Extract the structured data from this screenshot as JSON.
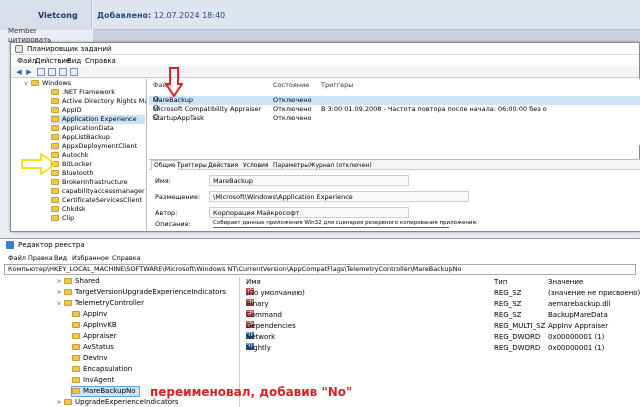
{
  "forum": {
    "username": "Vietcong",
    "added_label": "Добавлено:",
    "added_date": "12.07.2024 18:40",
    "member_line1": "Member",
    "member_line2": "цитировать"
  },
  "scheduler": {
    "title": "Планировщик заданий",
    "menu": [
      "Файл",
      "Действие",
      "Вид",
      "Справка"
    ],
    "tree": [
      {
        "label": "Windows",
        "indent": 0
      },
      {
        "label": ".NET Framework",
        "indent": 1
      },
      {
        "label": "Active Directory Rights Mana",
        "indent": 1
      },
      {
        "label": "AppID",
        "indent": 1
      },
      {
        "label": "Application Experience",
        "indent": 1,
        "selected": true
      },
      {
        "label": "ApplicationData",
        "indent": 1
      },
      {
        "label": "AppListBackup",
        "indent": 1
      },
      {
        "label": "AppxDeploymentClient",
        "indent": 1
      },
      {
        "label": "Autochk",
        "indent": 1
      },
      {
        "label": "BitLocker",
        "indent": 1
      },
      {
        "label": "Bluetooth",
        "indent": 1
      },
      {
        "label": "BrokerInfrastructure",
        "indent": 1
      },
      {
        "label": "capabilityaccessmanager",
        "indent": 1
      },
      {
        "label": "CertificateServicesClient",
        "indent": 1
      },
      {
        "label": "Chkdsk",
        "indent": 1
      },
      {
        "label": "Clip",
        "indent": 1
      }
    ],
    "columns": {
      "name": "Файл",
      "status": "Состояние",
      "triggers": "Триггеры"
    },
    "tasks": [
      {
        "name": "MareBackup",
        "status": "Отключено",
        "triggers": "",
        "selected": true
      },
      {
        "name": "Microsoft Compatibility Appraiser",
        "status": "Отключено",
        "triggers": "В 3:00 01.09.2008 - Частота повтора после начала: 06:00:00 без о"
      },
      {
        "name": "StartupAppTask",
        "status": "Отключено",
        "triggers": ""
      }
    ],
    "tabs": [
      "Общие",
      "Триггеры",
      "Действия",
      "Условия",
      "Параметры",
      "Журнал (отключен)"
    ],
    "details": {
      "name_label": "Имя:",
      "name_value": "MareBackup",
      "location_label": "Размещение:",
      "location_value": "\\Microsoft\\Windows\\Application Experience",
      "author_label": "Автор:",
      "author_value": "Корпорация Майкрософт",
      "desc_label": "Описание:",
      "desc_value": "Собирает данные приложения Win32 для сценария резервного копирования приложения."
    }
  },
  "registry": {
    "title": "Редактор реестра",
    "menu": [
      "Файл",
      "Правка",
      "Вид",
      "Избранное",
      "Справка"
    ],
    "path": "Компьютер\\HKEY_LOCAL_MACHINE\\SOFTWARE\\Microsoft\\Windows NT\\CurrentVersion\\AppCompatFlags\\TelemetryController\\MareBackupNo",
    "tree": [
      {
        "label": "Shared",
        "indent": 0,
        "chev": ">"
      },
      {
        "label": "TargetVersionUpgradeExperienceIndicators",
        "indent": 0,
        "chev": ">"
      },
      {
        "label": "TelemetryController",
        "indent": 0,
        "chev": "v"
      },
      {
        "label": "AppInv",
        "indent": 1,
        "chev": ""
      },
      {
        "label": "AppInvKB",
        "indent": 1,
        "chev": ""
      },
      {
        "label": "Appraiser",
        "indent": 1,
        "chev": ""
      },
      {
        "label": "AvStatus",
        "indent": 1,
        "chev": ""
      },
      {
        "label": "DevInv",
        "indent": 1,
        "chev": ""
      },
      {
        "label": "Encapsulation",
        "indent": 1,
        "chev": ""
      },
      {
        "label": "InvAgent",
        "indent": 1,
        "chev": ""
      },
      {
        "label": "MareBackupNo",
        "indent": 1,
        "chev": "",
        "selected": true
      },
      {
        "label": "UpgradeExperienceIndicators",
        "indent": 0,
        "chev": ">"
      }
    ],
    "columns": {
      "name": "Имя",
      "type": "Тип",
      "value": "Значение"
    },
    "values": [
      {
        "icon": "ab",
        "name": "(По умолчанию)",
        "type": "REG_SZ",
        "value": "(значение не присвоено)"
      },
      {
        "icon": "ab",
        "name": "Binary",
        "type": "REG_SZ",
        "value": "aemarebackup.dll"
      },
      {
        "icon": "ab",
        "name": "Command",
        "type": "REG_SZ",
        "value": "BackupMareData"
      },
      {
        "icon": "ab",
        "name": "Dependencies",
        "type": "REG_MULTI_SZ",
        "value": "AppInv Appraiser"
      },
      {
        "icon": "bin",
        "name": "Network",
        "type": "REG_DWORD",
        "value": "0x00000001 (1)"
      },
      {
        "icon": "bin",
        "name": "Nightly",
        "type": "REG_DWORD",
        "value": "0x00000001 (1)"
      }
    ]
  },
  "annotation": "переименовал, добавив \"No\""
}
